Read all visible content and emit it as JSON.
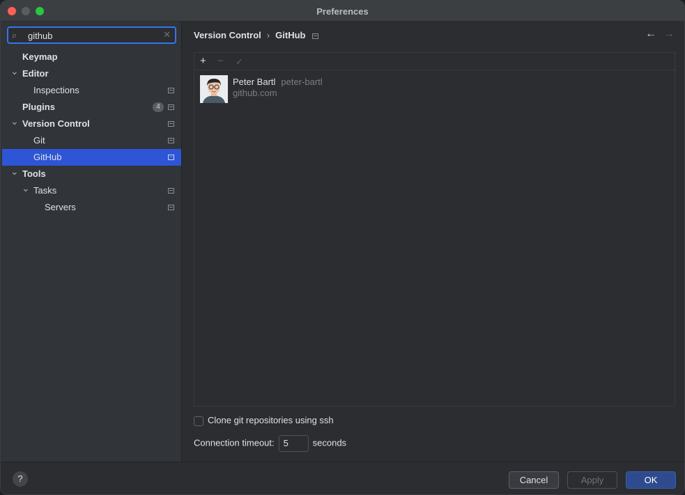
{
  "window": {
    "title": "Preferences"
  },
  "search": {
    "value": "github"
  },
  "tree": [
    {
      "label": "Keymap",
      "bold": true,
      "level": 0,
      "expander": "",
      "badge": "",
      "project": false,
      "selected": false
    },
    {
      "label": "Editor",
      "bold": true,
      "level": 0,
      "expander": "down",
      "badge": "",
      "project": false,
      "selected": false
    },
    {
      "label": "Inspections",
      "bold": false,
      "level": 1,
      "expander": "",
      "badge": "",
      "project": true,
      "selected": false
    },
    {
      "label": "Plugins",
      "bold": true,
      "level": 0,
      "expander": "",
      "badge": "4",
      "project": true,
      "selected": false
    },
    {
      "label": "Version Control",
      "bold": true,
      "level": 0,
      "expander": "down",
      "badge": "",
      "project": true,
      "selected": false
    },
    {
      "label": "Git",
      "bold": false,
      "level": 1,
      "expander": "",
      "badge": "",
      "project": true,
      "selected": false
    },
    {
      "label": "GitHub",
      "bold": false,
      "level": 1,
      "expander": "",
      "badge": "",
      "project": true,
      "selected": true
    },
    {
      "label": "Tools",
      "bold": true,
      "level": 0,
      "expander": "down",
      "badge": "",
      "project": false,
      "selected": false
    },
    {
      "label": "Tasks",
      "bold": false,
      "level": 1,
      "expander": "down",
      "badge": "",
      "project": true,
      "selected": false
    },
    {
      "label": "Servers",
      "bold": false,
      "level": 2,
      "expander": "",
      "badge": "",
      "project": true,
      "selected": false
    }
  ],
  "breadcrumb": {
    "parent": "Version Control",
    "separator": "›",
    "current": "GitHub"
  },
  "nav": {
    "back": "←",
    "forward": "→"
  },
  "accounts_toolbar": {
    "add": "+",
    "remove": "−",
    "check": "✓"
  },
  "accounts": [
    {
      "name": "Peter Bartl",
      "login": "peter-bartl",
      "server": "github.com"
    }
  ],
  "options": {
    "clone_ssh_label": "Clone git repositories using ssh",
    "clone_ssh_checked": false,
    "timeout_label": "Connection timeout:",
    "timeout_value": "5",
    "timeout_unit": "seconds"
  },
  "footer": {
    "help": "?",
    "cancel": "Cancel",
    "apply": "Apply",
    "ok": "OK"
  },
  "colors": {
    "selection": "#2e55d6",
    "search_focus": "#3574f0",
    "ok_button": "#2e4b8f"
  }
}
